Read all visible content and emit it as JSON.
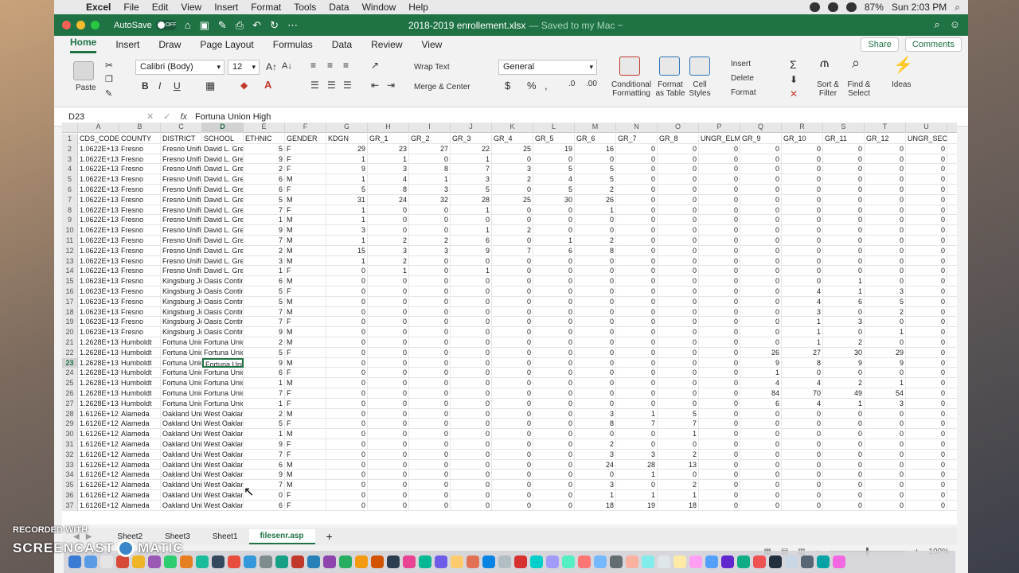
{
  "menubar": {
    "app": "Excel",
    "items": [
      "File",
      "Edit",
      "View",
      "Insert",
      "Format",
      "Tools",
      "Data",
      "Window",
      "Help"
    ],
    "battery": "87%",
    "clock": "Sun 2:03 PM"
  },
  "titlebar": {
    "autosave_label": "AutoSave",
    "autosave_state": "OFF",
    "document": "2018-2019 enrollement.xlsx",
    "saved_status": "— Saved to my Mac ~"
  },
  "ribbon_tabs": [
    "Home",
    "Insert",
    "Draw",
    "Page Layout",
    "Formulas",
    "Data",
    "Review",
    "View"
  ],
  "share_label": "Share",
  "comments_label": "Comments",
  "ribbon": {
    "paste": "Paste",
    "font_name": "Calibri (Body)",
    "font_size": "12",
    "wrap_text": "Wrap Text",
    "merge_center": "Merge & Center",
    "number_format": "General",
    "conditional_formatting": "Conditional Formatting",
    "format_as_table": "Format as Table",
    "cell_styles": "Cell Styles",
    "insert": "Insert",
    "delete": "Delete",
    "format": "Format",
    "sort_filter": "Sort & Filter",
    "find_select": "Find & Select",
    "ideas": "Ideas"
  },
  "formula_bar": {
    "name_box": "D23",
    "fx": "fx",
    "content": "Fortuna Union High"
  },
  "grid": {
    "columns": [
      "A",
      "B",
      "C",
      "D",
      "E",
      "F",
      "G",
      "H",
      "I",
      "J",
      "K",
      "L",
      "M",
      "N",
      "O",
      "P",
      "Q",
      "R",
      "S",
      "T",
      "U"
    ],
    "selected_column": "D",
    "selected_row": "23",
    "header_row": [
      "CDS_CODE",
      "COUNTY",
      "DISTRICT",
      "SCHOOL",
      "ETHNIC",
      "GENDER",
      "KDGN",
      "GR_1",
      "GR_2",
      "GR_3",
      "GR_4",
      "GR_5",
      "GR_6",
      "GR_7",
      "GR_8",
      "UNGR_ELM",
      "GR_9",
      "GR_10",
      "GR_11",
      "GR_12",
      "UNGR_SEC"
    ],
    "rows": [
      [
        "1.0622E+13",
        "Fresno",
        "Fresno Unifi",
        "David L. Gree",
        "5",
        "F",
        "29",
        "23",
        "27",
        "22",
        "25",
        "19",
        "16",
        "0",
        "0",
        "0",
        "0",
        "0",
        "0",
        "0",
        "0"
      ],
      [
        "1.0622E+13",
        "Fresno",
        "Fresno Unifi",
        "David L. Gree",
        "9",
        "F",
        "1",
        "1",
        "0",
        "1",
        "0",
        "0",
        "0",
        "0",
        "0",
        "0",
        "0",
        "0",
        "0",
        "0",
        "0"
      ],
      [
        "1.0622E+13",
        "Fresno",
        "Fresno Unifi",
        "David L. Gree",
        "2",
        "F",
        "9",
        "3",
        "8",
        "7",
        "3",
        "5",
        "5",
        "0",
        "0",
        "0",
        "0",
        "0",
        "0",
        "0",
        "0"
      ],
      [
        "1.0622E+13",
        "Fresno",
        "Fresno Unifi",
        "David L. Gree",
        "6",
        "M",
        "1",
        "4",
        "1",
        "3",
        "2",
        "4",
        "5",
        "0",
        "0",
        "0",
        "0",
        "0",
        "0",
        "0",
        "0"
      ],
      [
        "1.0622E+13",
        "Fresno",
        "Fresno Unifi",
        "David L. Gree",
        "6",
        "F",
        "5",
        "8",
        "3",
        "5",
        "0",
        "5",
        "2",
        "0",
        "0",
        "0",
        "0",
        "0",
        "0",
        "0",
        "0"
      ],
      [
        "1.0622E+13",
        "Fresno",
        "Fresno Unifi",
        "David L. Gree",
        "5",
        "M",
        "31",
        "24",
        "32",
        "28",
        "25",
        "30",
        "26",
        "0",
        "0",
        "0",
        "0",
        "0",
        "0",
        "0",
        "0"
      ],
      [
        "1.0622E+13",
        "Fresno",
        "Fresno Unifi",
        "David L. Gree",
        "7",
        "F",
        "1",
        "0",
        "0",
        "1",
        "0",
        "0",
        "1",
        "0",
        "0",
        "0",
        "0",
        "0",
        "0",
        "0",
        "0"
      ],
      [
        "1.0622E+13",
        "Fresno",
        "Fresno Unifi",
        "David L. Gree",
        "1",
        "M",
        "1",
        "0",
        "0",
        "0",
        "0",
        "0",
        "0",
        "0",
        "0",
        "0",
        "0",
        "0",
        "0",
        "0",
        "0"
      ],
      [
        "1.0622E+13",
        "Fresno",
        "Fresno Unifi",
        "David L. Gree",
        "9",
        "M",
        "3",
        "0",
        "0",
        "1",
        "2",
        "0",
        "0",
        "0",
        "0",
        "0",
        "0",
        "0",
        "0",
        "0",
        "0"
      ],
      [
        "1.0622E+13",
        "Fresno",
        "Fresno Unifi",
        "David L. Gree",
        "7",
        "M",
        "1",
        "2",
        "2",
        "6",
        "0",
        "1",
        "2",
        "0",
        "0",
        "0",
        "0",
        "0",
        "0",
        "0",
        "0"
      ],
      [
        "1.0622E+13",
        "Fresno",
        "Fresno Unifi",
        "David L. Gree",
        "2",
        "M",
        "15",
        "3",
        "3",
        "9",
        "7",
        "6",
        "8",
        "0",
        "0",
        "0",
        "0",
        "0",
        "0",
        "0",
        "0"
      ],
      [
        "1.0622E+13",
        "Fresno",
        "Fresno Unifi",
        "David L. Gree",
        "3",
        "M",
        "1",
        "2",
        "0",
        "0",
        "0",
        "0",
        "0",
        "0",
        "0",
        "0",
        "0",
        "0",
        "0",
        "0",
        "0"
      ],
      [
        "1.0622E+13",
        "Fresno",
        "Fresno Unifi",
        "David L. Gree",
        "1",
        "F",
        "0",
        "1",
        "0",
        "1",
        "0",
        "0",
        "0",
        "0",
        "0",
        "0",
        "0",
        "0",
        "0",
        "0",
        "0"
      ],
      [
        "1.0623E+13",
        "Fresno",
        "Kingsburg Jo",
        "Oasis Contin",
        "6",
        "M",
        "0",
        "0",
        "0",
        "0",
        "0",
        "0",
        "0",
        "0",
        "0",
        "0",
        "0",
        "0",
        "1",
        "0",
        "0"
      ],
      [
        "1.0623E+13",
        "Fresno",
        "Kingsburg Jo",
        "Oasis Contin",
        "5",
        "F",
        "0",
        "0",
        "0",
        "0",
        "0",
        "0",
        "0",
        "0",
        "0",
        "0",
        "0",
        "4",
        "1",
        "3",
        "0"
      ],
      [
        "1.0623E+13",
        "Fresno",
        "Kingsburg Jo",
        "Oasis Contin",
        "5",
        "M",
        "0",
        "0",
        "0",
        "0",
        "0",
        "0",
        "0",
        "0",
        "0",
        "0",
        "0",
        "4",
        "6",
        "5",
        "0"
      ],
      [
        "1.0623E+13",
        "Fresno",
        "Kingsburg Jo",
        "Oasis Contin",
        "7",
        "M",
        "0",
        "0",
        "0",
        "0",
        "0",
        "0",
        "0",
        "0",
        "0",
        "0",
        "0",
        "3",
        "0",
        "2",
        "0"
      ],
      [
        "1.0623E+13",
        "Fresno",
        "Kingsburg Jo",
        "Oasis Contin",
        "7",
        "F",
        "0",
        "0",
        "0",
        "0",
        "0",
        "0",
        "0",
        "0",
        "0",
        "0",
        "0",
        "1",
        "3",
        "0",
        "0"
      ],
      [
        "1.0623E+13",
        "Fresno",
        "Kingsburg Jo",
        "Oasis Contin",
        "9",
        "M",
        "0",
        "0",
        "0",
        "0",
        "0",
        "0",
        "0",
        "0",
        "0",
        "0",
        "0",
        "1",
        "0",
        "1",
        "0"
      ],
      [
        "1.2628E+13",
        "Humboldt",
        "Fortuna Unic",
        "Fortuna Unic",
        "2",
        "M",
        "0",
        "0",
        "0",
        "0",
        "0",
        "0",
        "0",
        "0",
        "0",
        "0",
        "0",
        "1",
        "2",
        "0",
        "0"
      ],
      [
        "1.2628E+13",
        "Humboldt",
        "Fortuna Unic",
        "Fortuna Unic",
        "5",
        "F",
        "0",
        "0",
        "0",
        "0",
        "0",
        "0",
        "0",
        "0",
        "0",
        "0",
        "26",
        "27",
        "30",
        "29",
        "0"
      ],
      [
        "1.2628E+13",
        "Humboldt",
        "Fortuna Unic",
        "Fortuna Unic",
        "9",
        "M",
        "0",
        "0",
        "0",
        "0",
        "0",
        "0",
        "0",
        "0",
        "0",
        "0",
        "9",
        "8",
        "9",
        "9",
        "0"
      ],
      [
        "1.2628E+13",
        "Humboldt",
        "Fortuna Unic",
        "Fortuna Unic",
        "6",
        "F",
        "0",
        "0",
        "0",
        "0",
        "0",
        "0",
        "0",
        "0",
        "0",
        "0",
        "1",
        "0",
        "0",
        "0",
        "0"
      ],
      [
        "1.2628E+13",
        "Humboldt",
        "Fortuna Unic",
        "Fortuna Unic",
        "1",
        "M",
        "0",
        "0",
        "0",
        "0",
        "0",
        "0",
        "0",
        "0",
        "0",
        "0",
        "4",
        "4",
        "2",
        "1",
        "0"
      ],
      [
        "1.2628E+13",
        "Humboldt",
        "Fortuna Unic",
        "Fortuna Unic",
        "7",
        "F",
        "0",
        "0",
        "0",
        "0",
        "0",
        "0",
        "0",
        "0",
        "0",
        "0",
        "84",
        "70",
        "49",
        "54",
        "0"
      ],
      [
        "1.2628E+13",
        "Humboldt",
        "Fortuna Unic",
        "Fortuna Unic",
        "1",
        "F",
        "0",
        "0",
        "0",
        "0",
        "0",
        "0",
        "0",
        "0",
        "0",
        "0",
        "6",
        "4",
        "1",
        "3",
        "0"
      ],
      [
        "1.6126E+12",
        "Alameda",
        "Oakland Unif",
        "West Oaklan",
        "2",
        "M",
        "0",
        "0",
        "0",
        "0",
        "0",
        "0",
        "3",
        "1",
        "5",
        "0",
        "0",
        "0",
        "0",
        "0",
        "0"
      ],
      [
        "1.6126E+12",
        "Alameda",
        "Oakland Unif",
        "West Oaklan",
        "5",
        "F",
        "0",
        "0",
        "0",
        "0",
        "0",
        "0",
        "8",
        "7",
        "7",
        "0",
        "0",
        "0",
        "0",
        "0",
        "0"
      ],
      [
        "1.6126E+12",
        "Alameda",
        "Oakland Unif",
        "West Oaklan",
        "1",
        "M",
        "0",
        "0",
        "0",
        "0",
        "0",
        "0",
        "0",
        "0",
        "1",
        "0",
        "0",
        "0",
        "0",
        "0",
        "0"
      ],
      [
        "1.6126E+12",
        "Alameda",
        "Oakland Unif",
        "West Oaklan",
        "9",
        "F",
        "0",
        "0",
        "0",
        "0",
        "0",
        "0",
        "2",
        "0",
        "0",
        "0",
        "0",
        "0",
        "0",
        "0",
        "0"
      ],
      [
        "1.6126E+12",
        "Alameda",
        "Oakland Unif",
        "West Oaklan",
        "7",
        "F",
        "0",
        "0",
        "0",
        "0",
        "0",
        "0",
        "3",
        "3",
        "2",
        "0",
        "0",
        "0",
        "0",
        "0",
        "0"
      ],
      [
        "1.6126E+12",
        "Alameda",
        "Oakland Unif",
        "West Oaklan",
        "6",
        "M",
        "0",
        "0",
        "0",
        "0",
        "0",
        "0",
        "24",
        "28",
        "13",
        "0",
        "0",
        "0",
        "0",
        "0",
        "0"
      ],
      [
        "1.6126E+12",
        "Alameda",
        "Oakland Unif",
        "West Oaklan",
        "9",
        "M",
        "0",
        "0",
        "0",
        "0",
        "0",
        "0",
        "0",
        "1",
        "0",
        "0",
        "0",
        "0",
        "0",
        "0",
        "0"
      ],
      [
        "1.6126E+12",
        "Alameda",
        "Oakland Unif",
        "West Oaklan",
        "7",
        "M",
        "0",
        "0",
        "0",
        "0",
        "0",
        "0",
        "3",
        "0",
        "2",
        "0",
        "0",
        "0",
        "0",
        "0",
        "0"
      ],
      [
        "1.6126E+12",
        "Alameda",
        "Oakland Unif",
        "West Oaklan",
        "0",
        "F",
        "0",
        "0",
        "0",
        "0",
        "0",
        "0",
        "1",
        "1",
        "1",
        "0",
        "0",
        "0",
        "0",
        "0",
        "0"
      ],
      [
        "1.6126E+12",
        "Alameda",
        "Oakland Unif",
        "West Oaklan",
        "6",
        "F",
        "0",
        "0",
        "0",
        "0",
        "0",
        "0",
        "18",
        "19",
        "18",
        "0",
        "0",
        "0",
        "0",
        "0",
        "0"
      ]
    ]
  },
  "sheet_tabs": [
    "Sheet2",
    "Sheet3",
    "Sheet1",
    "filesenr.asp"
  ],
  "active_sheet": "filesenr.asp",
  "add_sheet": "+",
  "zoom": "100%",
  "watermark": {
    "line1": "RECORDED WITH",
    "line2a": "SCREENCAST",
    "line2b": "MATIC"
  },
  "colors": {
    "excel_green": "#1f7244",
    "menubar": "#e9e9e9"
  }
}
